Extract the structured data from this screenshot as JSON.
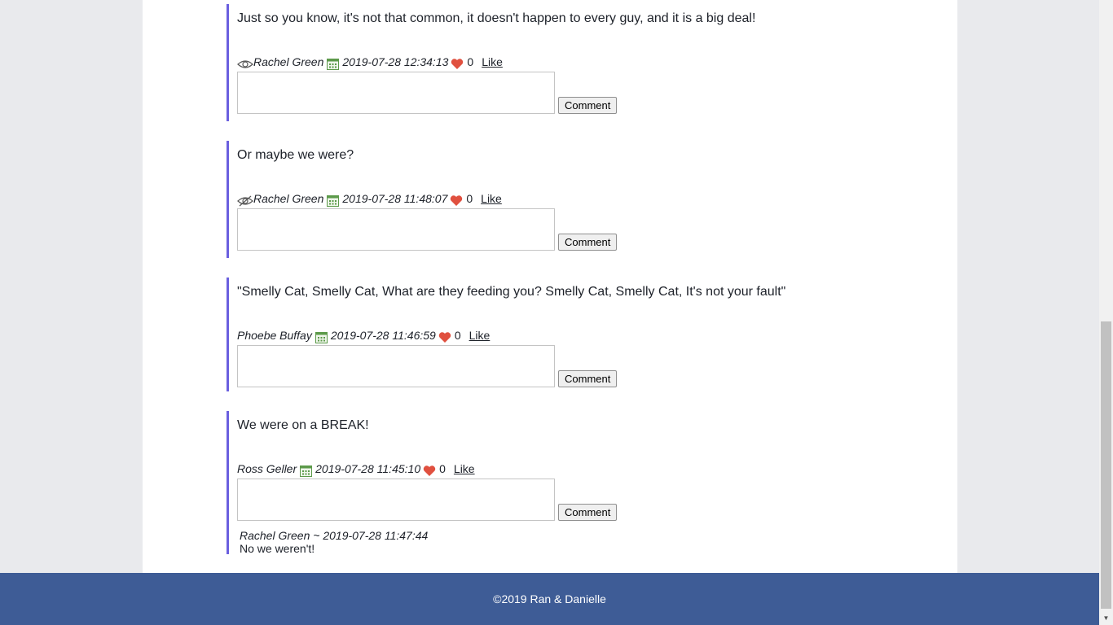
{
  "posts": [
    {
      "text": "Just so you know, it's not that common, it doesn't happen to every guy, and it is a big deal!",
      "visibility_icon": "eye-icon",
      "author": "Rachel Green",
      "date": "2019-07-28 12:34:13",
      "likes": "0",
      "like_label": "Like",
      "comment_button": "Comment",
      "comment_placeholder": ""
    },
    {
      "text": "Or maybe we were?",
      "visibility_icon": "eye-slash-icon",
      "author": "Rachel Green",
      "date": "2019-07-28 11:48:07",
      "likes": "0",
      "like_label": "Like",
      "comment_button": "Comment",
      "comment_placeholder": ""
    },
    {
      "text": "\"Smelly Cat, Smelly Cat, What are they feeding you? Smelly Cat, Smelly Cat, It's not your fault\"",
      "author": "Phoebe Buffay",
      "date": "2019-07-28 11:46:59",
      "likes": "0",
      "like_label": "Like",
      "comment_button": "Comment",
      "comment_placeholder": ""
    },
    {
      "text": "We were on a BREAK!",
      "author": "Ross Geller",
      "date": "2019-07-28 11:45:10",
      "likes": "0",
      "like_label": "Like",
      "comment_button": "Comment",
      "comment_placeholder": "",
      "replies": [
        {
          "meta": "Rachel Green ~ 2019-07-28 11:47:44",
          "text": "No we weren't!"
        }
      ]
    }
  ],
  "footer": {
    "text": "©2019 Ran & Danielle"
  },
  "colors": {
    "accent_border": "#6a5fdf",
    "footer_bg": "#3e5c96",
    "heart": "#e0503f",
    "calendar": "#5c9a4a"
  }
}
